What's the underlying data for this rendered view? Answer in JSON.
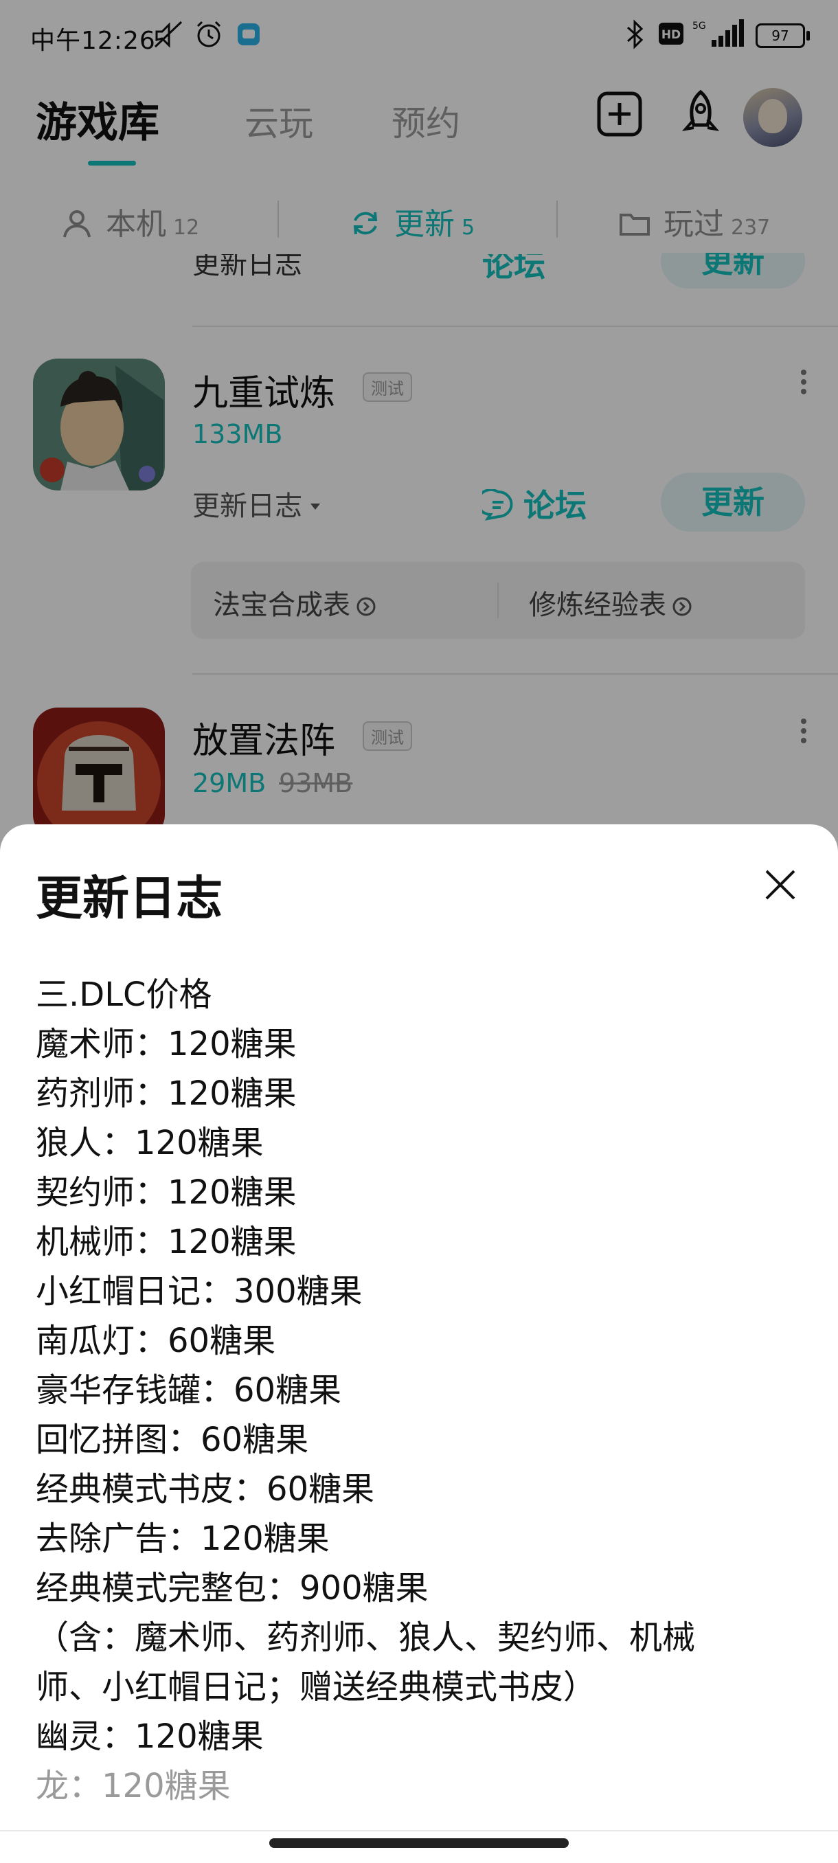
{
  "status_bar": {
    "time": "中午12:26",
    "battery": "97",
    "network": "5G",
    "hd": "HD"
  },
  "header": {
    "tabs": [
      {
        "label": "游戏库",
        "active": true
      },
      {
        "label": "云玩",
        "active": false
      },
      {
        "label": "预约",
        "active": false
      }
    ],
    "icons": [
      "add-square-icon",
      "rocket-icon",
      "avatar"
    ]
  },
  "segments": [
    {
      "label": "本机",
      "count": "12",
      "icon": "user-device-icon",
      "active": false
    },
    {
      "label": "更新",
      "count": "5",
      "icon": "refresh-icon",
      "active": true
    },
    {
      "label": "玩过",
      "count": "237",
      "icon": "folder-icon",
      "active": false
    }
  ],
  "partial_item": {
    "changelog": "更新日志",
    "forum": "论坛",
    "update": "更新"
  },
  "games": [
    {
      "title": "九重试炼",
      "badge": "测试",
      "size": "133MB",
      "changelog": "更新日志",
      "forum": "论坛",
      "update": "更新",
      "tools": [
        "法宝合成表",
        "修炼经验表"
      ]
    },
    {
      "title": "放置法阵",
      "badge": "测试",
      "size": "29MB",
      "size_old": "93MB"
    }
  ],
  "sheet": {
    "title": "更新日志",
    "lines": [
      "三.DLC价格",
      "魔术师：120糖果",
      "药剂师：120糖果",
      "狼人：120糖果",
      "契约师：120糖果",
      "机械师：120糖果",
      "小红帽日记：300糖果",
      "南瓜灯：60糖果",
      "豪华存钱罐：60糖果",
      "回忆拼图：60糖果",
      "经典模式书皮：60糖果",
      "去除广告：120糖果",
      "经典模式完整包：900糖果",
      "（含：魔术师、药剂师、狼人、契约师、机械",
      "师、小红帽日记；赠送经典模式书皮）",
      "幽灵：120糖果",
      "龙：120糖果"
    ]
  },
  "colors": {
    "accent": "#14c0bd",
    "overlay": "rgba(0,0,0,0.38)"
  }
}
